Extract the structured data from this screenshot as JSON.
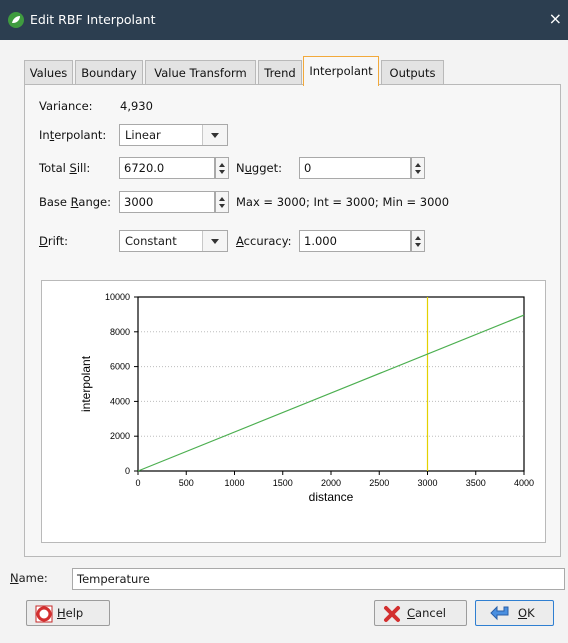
{
  "window": {
    "title": "Edit RBF Interpolant",
    "close": "×"
  },
  "tabs": [
    {
      "label": "Values"
    },
    {
      "label": "Boundary"
    },
    {
      "label": "Value Transform"
    },
    {
      "label": "Trend"
    },
    {
      "label": "Interpolant"
    },
    {
      "label": "Outputs"
    }
  ],
  "active_tab": "Interpolant",
  "form": {
    "variance_label": "Variance:",
    "variance_value": "4,930",
    "interpolant_label_pre": "In",
    "interpolant_label_u": "t",
    "interpolant_label_post": "erpolant:",
    "interpolant_value": "Linear",
    "total_sill_label_pre": "Total ",
    "total_sill_label_u": "S",
    "total_sill_label_post": "ill:",
    "total_sill_value": "6720.0",
    "nugget_label_pre": "N",
    "nugget_label_u": "u",
    "nugget_label_post": "gget:",
    "nugget_value": "0",
    "base_range_label_pre": "Base ",
    "base_range_label_u": "R",
    "base_range_label_post": "ange:",
    "base_range_value": "3000",
    "range_info": "Max = 3000; Int = 3000; Min = 3000",
    "drift_label_u": "D",
    "drift_label_post": "rift:",
    "drift_value": "Constant",
    "accuracy_label_u": "A",
    "accuracy_label_post": "ccuracy:",
    "accuracy_value": "1.000"
  },
  "chart_data": {
    "type": "line",
    "title": "",
    "xlabel": "distance",
    "ylabel": "interpolant",
    "xlim": [
      0,
      4000
    ],
    "ylim": [
      0,
      10000
    ],
    "xticks": [
      0,
      500,
      1000,
      1500,
      2000,
      2500,
      3000,
      3500,
      4000
    ],
    "yticks": [
      0,
      2000,
      4000,
      6000,
      8000,
      10000
    ],
    "grid": true,
    "series": [
      {
        "x": [
          0,
          4000
        ],
        "y": [
          0,
          8960
        ],
        "color": "#4caf50"
      }
    ],
    "vertical_line": {
      "x": 3000,
      "color": "#e3d200"
    }
  },
  "footer": {
    "name_label_u": "N",
    "name_label_post": "ame:",
    "name_value": "Temperature",
    "help_u": "H",
    "help_post": "elp",
    "cancel_u": "C",
    "cancel_post": "ancel",
    "ok_u": "O",
    "ok_post": "K"
  },
  "icons": {
    "app": "app-leaf-icon",
    "help": "help-lifebuoy-icon",
    "cancel": "cancel-x-icon",
    "ok": "ok-arrow-icon"
  }
}
